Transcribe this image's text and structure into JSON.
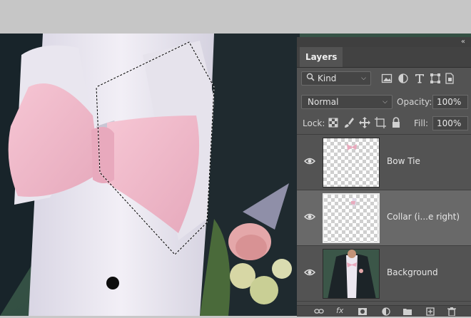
{
  "panel": {
    "collapse_glyph": "«",
    "tab_label": "Layers",
    "filter": {
      "label": "Kind",
      "icons": [
        "image-filter-icon",
        "adjustment-filter-icon",
        "type-filter-icon",
        "shape-filter-icon",
        "smart-object-filter-icon"
      ]
    },
    "blend_mode": "Normal",
    "opacity_label": "Opacity:",
    "opacity_value": "100%",
    "lock_label": "Lock:",
    "lock_icons": [
      "lock-transparent-pixels-icon",
      "lock-image-pixels-icon",
      "lock-position-icon",
      "lock-artboard-icon",
      "lock-all-icon"
    ],
    "fill_label": "Fill:",
    "fill_value": "100%",
    "layers": [
      {
        "name": "Bow Tie",
        "visible": true,
        "selected": false
      },
      {
        "name": "Collar (i...e right)",
        "visible": true,
        "selected": true
      },
      {
        "name": "Background",
        "visible": true,
        "selected": false
      }
    ],
    "bottom_icons": [
      "link-layers-icon",
      "fx-icon",
      "add-mask-icon",
      "adjustment-layer-icon",
      "new-group-icon",
      "new-layer-icon",
      "delete-layer-icon"
    ],
    "fx_label": "fx"
  },
  "colors": {
    "panel_bg": "#535353",
    "selected_layer": "#696969",
    "suit": "#1c2428",
    "shirt": "#ece8f0",
    "bow_tie": "#f0b8c8",
    "background_green": "#3a5a4a"
  }
}
